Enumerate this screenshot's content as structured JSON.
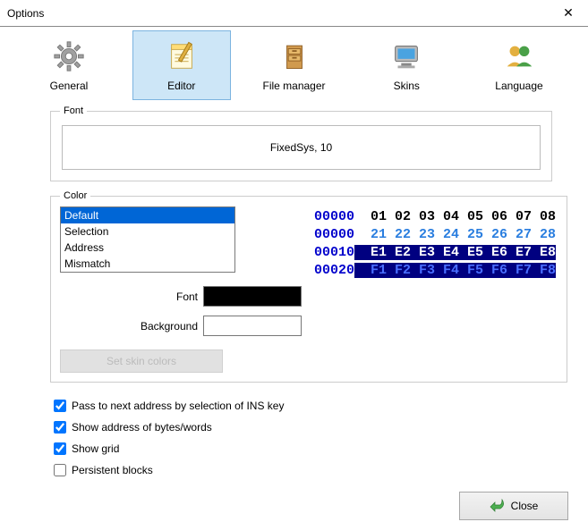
{
  "window": {
    "title": "Options"
  },
  "tabs": {
    "general": "General",
    "editor": "Editor",
    "file_manager": "File manager",
    "skins": "Skins",
    "language": "Language",
    "selected": "editor"
  },
  "font_group": {
    "legend": "Font",
    "value": "FixedSys, 10"
  },
  "color_group": {
    "legend": "Color",
    "list": [
      "Default",
      "Selection",
      "Address",
      "Mismatch"
    ],
    "selected": "Default",
    "font_label": "Font",
    "font_swatch": "#000000",
    "background_label": "Background",
    "background_swatch": "#FFFFFF",
    "skin_button": "Set skin colors",
    "preview": {
      "rows": [
        {
          "addr": "00000",
          "bytes": [
            "01",
            "02",
            "03",
            "04",
            "05",
            "06",
            "07",
            "08"
          ],
          "style": "header"
        },
        {
          "addr": "00000",
          "bytes": [
            "21",
            "22",
            "23",
            "24",
            "25",
            "26",
            "27",
            "28"
          ],
          "style": "data"
        },
        {
          "addr": "00010",
          "bytes": [
            "E1",
            "E2",
            "E3",
            "E4",
            "E5",
            "E6",
            "E7",
            "E8"
          ],
          "style": "selected"
        },
        {
          "addr": "00020",
          "bytes": [
            "F1",
            "F2",
            "F3",
            "F4",
            "F5",
            "F6",
            "F7",
            "F8"
          ],
          "style": "mismatch"
        }
      ],
      "colors": {
        "addr": "#0000CC",
        "header_bytes": "#000000",
        "data_bytes": "#2A7EDF",
        "selected_bg": "#000080",
        "selected_fg": "#FFFFFF",
        "mismatch_bytes": "#4A6FFF"
      }
    }
  },
  "checks": {
    "pass_ins": {
      "label": "Pass to next address by selection of INS key",
      "checked": true
    },
    "show_addr": {
      "label": "Show address of bytes/words",
      "checked": true
    },
    "show_grid": {
      "label": "Show grid",
      "checked": true
    },
    "persistent": {
      "label": "Persistent blocks",
      "checked": false
    }
  },
  "footer": {
    "close": "Close"
  }
}
